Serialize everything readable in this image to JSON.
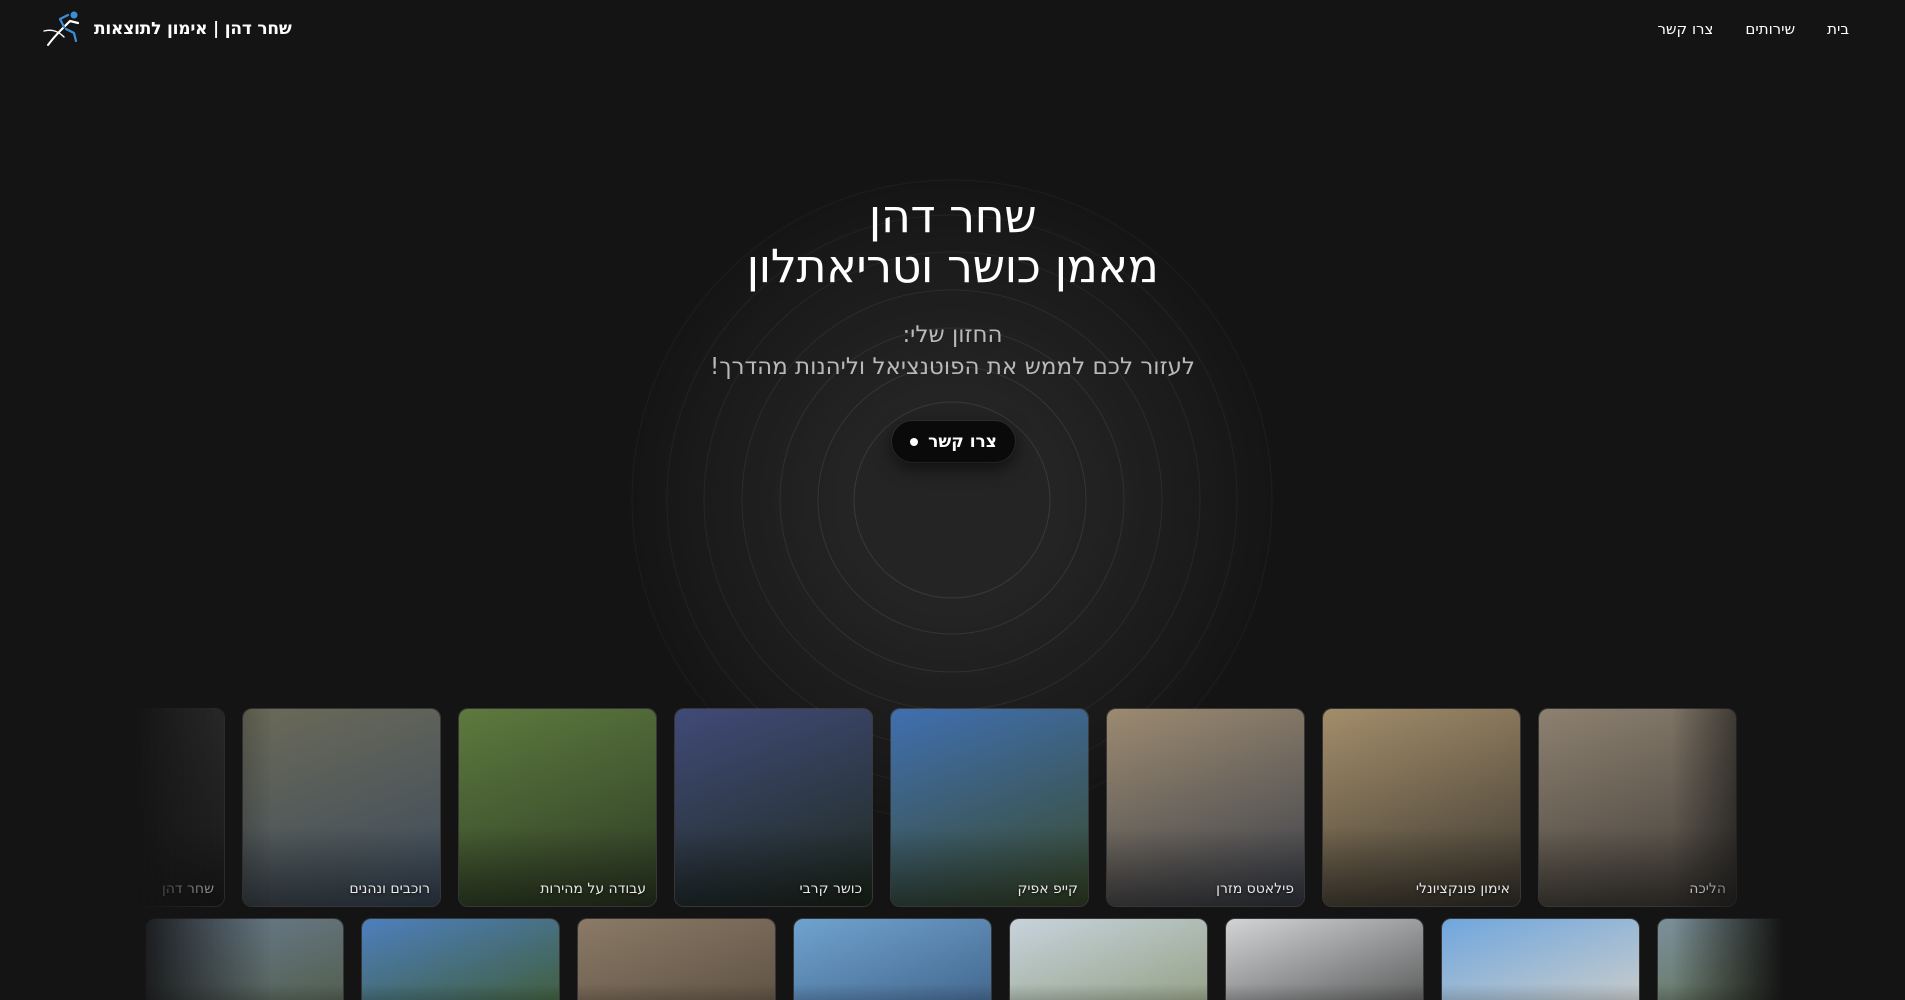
{
  "header": {
    "brand": "שחר דהן | אימון לתוצאות",
    "logo_icon": "runner-icon",
    "nav": [
      {
        "label": "בית"
      },
      {
        "label": "שירותים"
      },
      {
        "label": "צרו קשר"
      }
    ]
  },
  "hero": {
    "title_line1": "שחר דהן",
    "title_line2": "מאמן כושר וטריאתלון",
    "subtitle_line1": "החזון שלי:",
    "subtitle_line2": "לעזור לכם לממש את הפוטנציאל וליהנות מהדרך!",
    "cta_label": "צרו קשר"
  },
  "gallery": {
    "row1": [
      {
        "caption": "שחר דהן",
        "colors": [
          "#3a3a3a",
          "#1d1d1d"
        ]
      },
      {
        "caption": "רוכבים ונהנים",
        "colors": [
          "#6b6a58",
          "#3b4a5c"
        ]
      },
      {
        "caption": "עבודה על מהירות",
        "colors": [
          "#5d7a3e",
          "#2d3b25"
        ]
      },
      {
        "caption": "כושר קרבי",
        "colors": [
          "#404a78",
          "#1e2a1e"
        ]
      },
      {
        "caption": "קייפ אפיק",
        "colors": [
          "#3f6fb0",
          "#3a4a2a"
        ]
      },
      {
        "caption": "פילאטס מזרן",
        "colors": [
          "#9c8a70",
          "#3a3f4a"
        ]
      },
      {
        "caption": "אימון פונקציונלי",
        "colors": [
          "#a38d6a",
          "#3c3830"
        ]
      },
      {
        "caption": "הליכה",
        "colors": [
          "#8d8170",
          "#3e3a36"
        ]
      }
    ],
    "row2": [
      {
        "colors": [
          "#6c7f95",
          "#4f5a45"
        ]
      },
      {
        "colors": [
          "#4d7fbe",
          "#3f5a2a"
        ]
      },
      {
        "colors": [
          "#8a7a66",
          "#5a4d40"
        ]
      },
      {
        "colors": [
          "#6fa3cf",
          "#3d5e84"
        ]
      },
      {
        "colors": [
          "#c7d3dc",
          "#8d9a7a"
        ]
      },
      {
        "colors": [
          "#d2d4d6",
          "#4a4a4a"
        ]
      },
      {
        "colors": [
          "#6fa6de",
          "#d6d2c8"
        ]
      },
      {
        "colors": [
          "#7b8f9c",
          "#5a6a3a"
        ]
      }
    ]
  },
  "colors": {
    "background": "#141414",
    "subtitle": "#b9b9b9",
    "cta_bg": "#0a0a0a"
  }
}
